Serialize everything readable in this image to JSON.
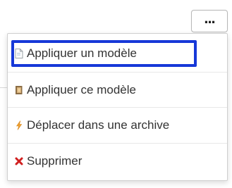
{
  "toolbar": {
    "more_button_label": "...",
    "more_button_icon": "ellipsis-icon"
  },
  "menu": {
    "items": [
      {
        "label": "Appliquer un modèle",
        "icon": "document-template-icon",
        "highlighted": true
      },
      {
        "label": "Appliquer ce modèle",
        "icon": "folder-template-icon"
      },
      {
        "label": "Déplacer dans une archive",
        "icon": "archive-lightning-icon"
      },
      {
        "label": "Supprimer",
        "icon": "delete-x-icon",
        "icon_color": "#d02020"
      }
    ]
  },
  "colors": {
    "highlight_border": "#1638d8",
    "text": "#333333",
    "archive_icon": "#f0a030",
    "delete_icon": "#d02020"
  }
}
